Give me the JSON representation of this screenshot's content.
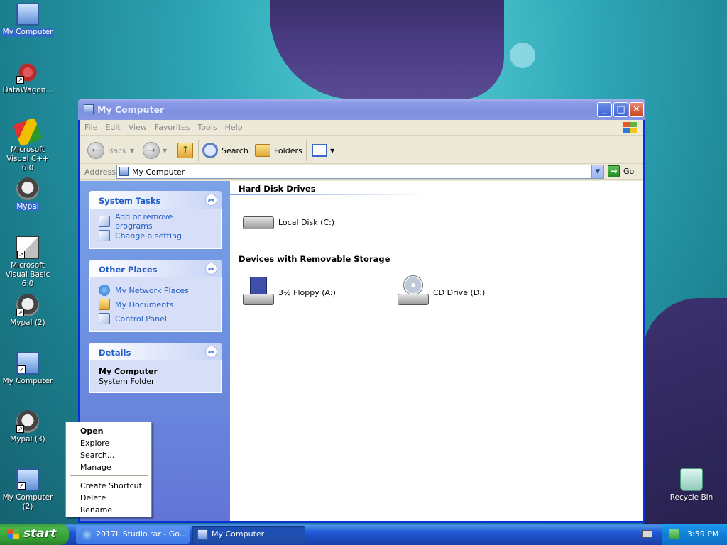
{
  "desktop": {
    "icons": [
      {
        "label": "My Computer"
      },
      {
        "label": "DataWagon..."
      },
      {
        "label": "Microsoft Visual C++ 6.0"
      },
      {
        "label": "Mypal"
      },
      {
        "label": "Microsoft Visual Basic 6.0"
      },
      {
        "label": "Mypal (2)"
      },
      {
        "label": "My Computer"
      },
      {
        "label": "Mypal (3)"
      },
      {
        "label": "My Computer (2)"
      },
      {
        "label": "Recycle Bin"
      }
    ]
  },
  "window": {
    "title": "My Computer",
    "menu": [
      "File",
      "Edit",
      "View",
      "Favorites",
      "Tools",
      "Help"
    ],
    "toolbar": {
      "back": "Back",
      "search": "Search",
      "folders": "Folders"
    },
    "address": {
      "label": "Address",
      "value": "My Computer",
      "go": "Go"
    },
    "taskpane": {
      "system_tasks": {
        "title": "System Tasks",
        "links": [
          "Add or remove programs",
          "Change a setting"
        ]
      },
      "other_places": {
        "title": "Other Places",
        "links": [
          "My Network Places",
          "My Documents",
          "Control Panel"
        ]
      },
      "details": {
        "title": "Details",
        "name": "My Computer",
        "type": "System Folder"
      }
    },
    "groups": {
      "hard_disks": {
        "title": "Hard Disk Drives",
        "drives": [
          "Local Disk (C:)"
        ]
      },
      "removable": {
        "title": "Devices with Removable Storage",
        "drives": [
          "3½ Floppy (A:)",
          "CD Drive (D:)"
        ]
      }
    }
  },
  "context_menu": {
    "items": [
      "Open",
      "Explore",
      "Search...",
      "Manage",
      "Create Shortcut",
      "Delete",
      "Rename"
    ]
  },
  "taskbar": {
    "start": "start",
    "buttons": [
      "2017L Studio.rar - Go...",
      "My Computer"
    ],
    "clock": "3:59 PM"
  }
}
